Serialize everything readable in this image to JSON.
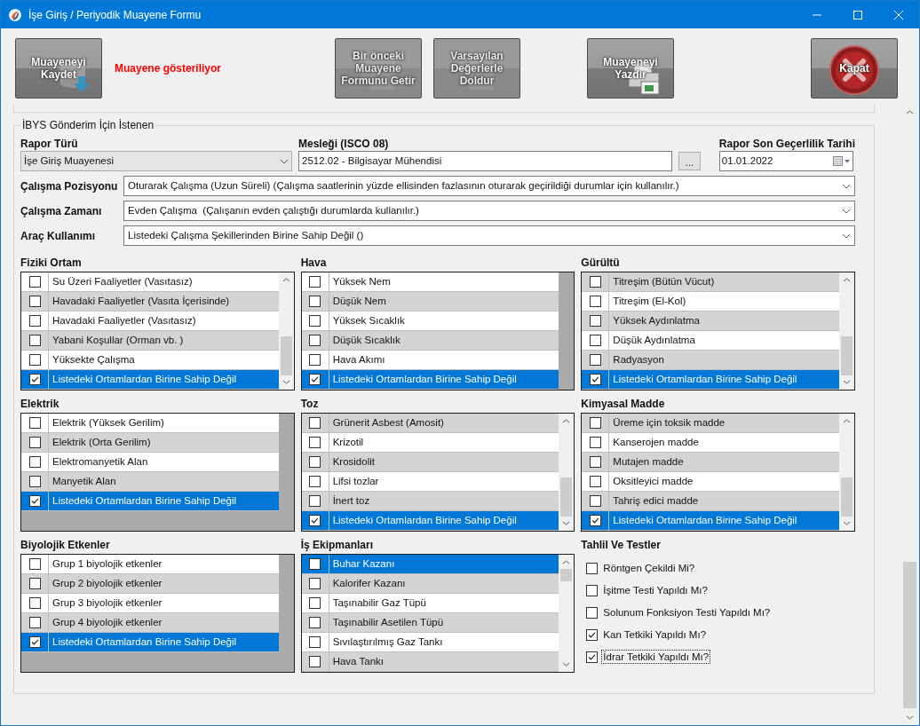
{
  "window": {
    "title": "İşe Giriş / Periyodik Muayene Formu"
  },
  "toolbar": {
    "status": "Muayene gösteriliyor",
    "buttons": [
      {
        "label": "Muayeneyi Kaydet",
        "kind": "save",
        "disabled": false
      },
      {
        "label": "Bir önceki Muayene Formunu Getir",
        "kind": "copy",
        "disabled": true
      },
      {
        "label": "Varsayılan Değerlerle Doldur",
        "kind": "defaults",
        "disabled": true
      },
      {
        "label": "Muayeneyi Yazdır",
        "kind": "print",
        "disabled": false
      },
      {
        "label": "Kapat",
        "kind": "close",
        "disabled": false
      }
    ]
  },
  "form": {
    "group_title": "İBYS Gönderim İçin İstenen",
    "report_type": {
      "label": "Rapor Türü",
      "value": "İşe Giriş Muayenesi"
    },
    "occupation": {
      "label": "Mesleği (ISCO 08)",
      "value": "2512.02 - Bilgisayar Mühendisi",
      "button": "..."
    },
    "expiry": {
      "label": "Rapor Son Geçerlilik Tarihi",
      "value": "01.01.2022"
    },
    "selects": [
      {
        "label": "Çalışma Pozisyonu",
        "value": "Oturarak Çalışma (Uzun Süreli) (Çalışma saatlerinin yüzde ellisinden fazlasının oturarak geçirildiği durumlar için kullanılır.)"
      },
      {
        "label": "Çalışma Zamanı",
        "value": "Evden Çalışma  (Çalışanın evden çalıştığı durumlarda kullanılır.)"
      },
      {
        "label": "Araç Kullanımı",
        "value": "Listedeki Çalışma Şekillerinden Birine Sahip Değil ()"
      }
    ]
  },
  "lists": [
    {
      "title": "Fiziki Ortam",
      "kind": "scroll_bottom",
      "rows": [
        {
          "label": "Su Üzeri Faaliyetler (Vasıtasız)",
          "checked": false,
          "selected": false,
          "shaded": false
        },
        {
          "label": "Havadaki Faaliyetler (Vasıta İçerisinde)",
          "checked": false,
          "selected": false,
          "shaded": true
        },
        {
          "label": "Havadaki Faaliyetler (Vasıtasız)",
          "checked": false,
          "selected": false,
          "shaded": false
        },
        {
          "label": "Yabani Koşullar (Orman vb. )",
          "checked": false,
          "selected": false,
          "shaded": true
        },
        {
          "label": "Yüksekte Çalışma",
          "checked": false,
          "selected": false,
          "shaded": false
        },
        {
          "label": "Listedeki Ortamlardan Birine Sahip Değil",
          "checked": true,
          "selected": true
        }
      ]
    },
    {
      "title": "Hava",
      "kind": "plain",
      "rows": [
        {
          "label": "Yüksek Nem",
          "checked": false,
          "selected": false,
          "shaded": false
        },
        {
          "label": "Düşük Nem",
          "checked": false,
          "selected": false,
          "shaded": true
        },
        {
          "label": "Yüksek Sıcaklık",
          "checked": false,
          "selected": false,
          "shaded": false
        },
        {
          "label": "Düşük Sıcaklık",
          "checked": false,
          "selected": false,
          "shaded": true
        },
        {
          "label": "Hava Akımı",
          "checked": false,
          "selected": false,
          "shaded": false
        },
        {
          "label": "Listedeki Ortamlardan Birine Sahip Değil",
          "checked": true,
          "selected": true
        }
      ]
    },
    {
      "title": "Gürültü",
      "kind": "scroll_bottom",
      "rows": [
        {
          "label": "Titreşim (Bütün Vücut)",
          "checked": false,
          "selected": false,
          "shaded": true
        },
        {
          "label": "Titreşim (El-Kol)",
          "checked": false,
          "selected": false,
          "shaded": false
        },
        {
          "label": "Yüksek Aydınlatma",
          "checked": false,
          "selected": false,
          "shaded": true
        },
        {
          "label": "Düşük Aydınlatma",
          "checked": false,
          "selected": false,
          "shaded": false
        },
        {
          "label": "Radyasyon",
          "checked": false,
          "selected": false,
          "shaded": true
        },
        {
          "label": "Listedeki Ortamlardan Birine Sahip Değil",
          "checked": true,
          "selected": true
        }
      ]
    },
    {
      "title": "Elektrik",
      "kind": "plain",
      "rows": [
        {
          "label": "Elektrik (Yüksek Gerilim)",
          "checked": false,
          "selected": false,
          "shaded": false
        },
        {
          "label": "Elektrik (Orta Gerilim)",
          "checked": false,
          "selected": false,
          "shaded": true
        },
        {
          "label": "Elektromanyetik Alan",
          "checked": false,
          "selected": false,
          "shaded": false
        },
        {
          "label": "Manyetik Alan",
          "checked": false,
          "selected": false,
          "shaded": true
        },
        {
          "label": "Listedeki Ortamlardan Birine Sahip Değil",
          "checked": true,
          "selected": true
        }
      ]
    },
    {
      "title": "Toz",
      "kind": "scroll_bottom",
      "rows": [
        {
          "label": "Grünerit Asbest (Amosit)",
          "checked": false,
          "selected": false,
          "shaded": true
        },
        {
          "label": "Krizotil",
          "checked": false,
          "selected": false,
          "shaded": false
        },
        {
          "label": "Krosidolit",
          "checked": false,
          "selected": false,
          "shaded": true
        },
        {
          "label": "Lifsi tozlar",
          "checked": false,
          "selected": false,
          "shaded": false
        },
        {
          "label": "İnert toz",
          "checked": false,
          "selected": false,
          "shaded": true
        },
        {
          "label": "Listedeki Ortamlardan Birine Sahip Değil",
          "checked": true,
          "selected": true
        }
      ]
    },
    {
      "title": "Kimyasal Madde",
      "kind": "scroll_bottom",
      "rows": [
        {
          "label": "Üreme için toksik madde",
          "checked": false,
          "selected": false,
          "shaded": true
        },
        {
          "label": "Kanserojen madde",
          "checked": false,
          "selected": false,
          "shaded": false
        },
        {
          "label": "Mutajen madde",
          "checked": false,
          "selected": false,
          "shaded": true
        },
        {
          "label": "Oksitleyici madde",
          "checked": false,
          "selected": false,
          "shaded": false
        },
        {
          "label": "Tahriş edici madde",
          "checked": false,
          "selected": false,
          "shaded": true
        },
        {
          "label": "Listedeki Ortamlardan Birine Sahip Değil",
          "checked": true,
          "selected": true
        }
      ]
    },
    {
      "title": "Biyolojik Etkenler",
      "kind": "plain",
      "rows": [
        {
          "label": "Grup 1 biyolojik etkenler",
          "checked": false,
          "selected": false,
          "shaded": false
        },
        {
          "label": "Grup 2 biyolojik etkenler",
          "checked": false,
          "selected": false,
          "shaded": true
        },
        {
          "label": "Grup 3 biyolojik etkenler",
          "checked": false,
          "selected": false,
          "shaded": false
        },
        {
          "label": "Grup 4 biyolojik etkenler",
          "checked": false,
          "selected": false,
          "shaded": true
        },
        {
          "label": "Listedeki Ortamlardan Birine Sahip Değil",
          "checked": true,
          "selected": true
        }
      ]
    },
    {
      "title": "İş Ekipmanları",
      "kind": "scroll_top",
      "rows": [
        {
          "label": "Buhar Kazanı",
          "checked": false,
          "selected": true
        },
        {
          "label": "Kalorifer Kazanı",
          "checked": false,
          "selected": false,
          "shaded": true
        },
        {
          "label": "Taşınabilir Gaz Tüpü",
          "checked": false,
          "selected": false,
          "shaded": false
        },
        {
          "label": "Taşınabilir Asetilen Tüpü",
          "checked": false,
          "selected": false,
          "shaded": true
        },
        {
          "label": "Sıvılaştırılmış Gaz Tankı",
          "checked": false,
          "selected": false,
          "shaded": false
        },
        {
          "label": "Hava Tankı",
          "checked": false,
          "selected": false,
          "shaded": true
        }
      ]
    }
  ],
  "tests": {
    "title": "Tahlil Ve Testler",
    "items": [
      {
        "label": "Röntgen Çekildi Mi?",
        "checked": false,
        "focused": false
      },
      {
        "label": "İşitme Testi Yapıldı Mı?",
        "checked": false,
        "focused": false
      },
      {
        "label": "Solunum Fonksiyon Testi Yapıldı Mı?",
        "checked": false,
        "focused": false
      },
      {
        "label": "Kan Tetkiki Yapıldı Mı?",
        "checked": true,
        "focused": false
      },
      {
        "label": "İdrar Tetkiki Yapıldı Mı?",
        "checked": true,
        "focused": true
      }
    ]
  }
}
